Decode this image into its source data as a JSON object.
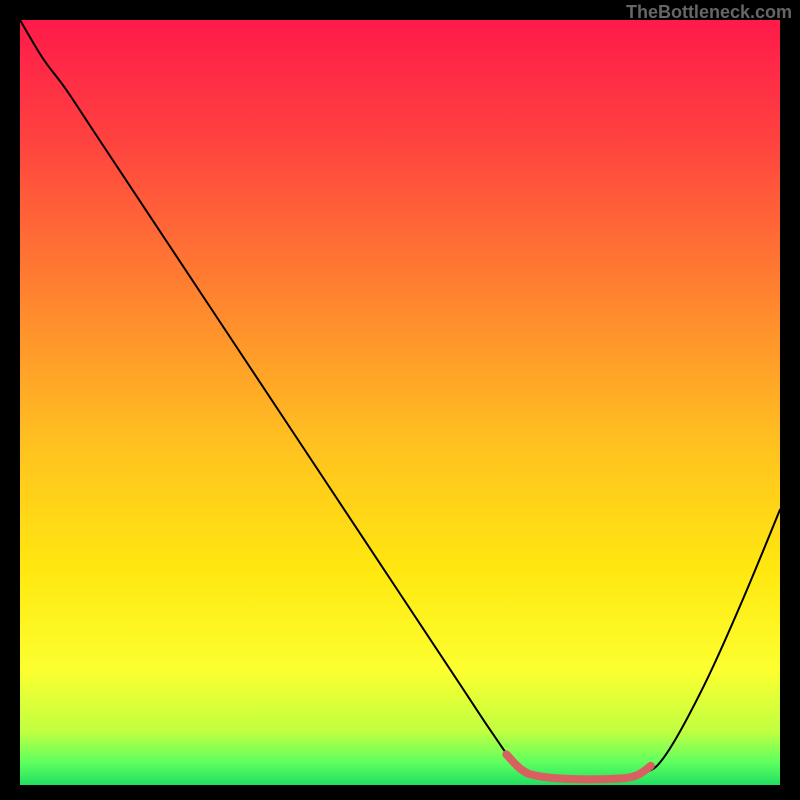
{
  "watermark": "TheBottleneck.com",
  "chart_data": {
    "type": "line",
    "title": "",
    "xlabel": "",
    "ylabel": "",
    "xlim": [
      0,
      100
    ],
    "ylim": [
      0,
      100
    ],
    "gradient_stops": [
      {
        "offset": 0.0,
        "color": "#ff1a4a"
      },
      {
        "offset": 0.15,
        "color": "#ff4040"
      },
      {
        "offset": 0.35,
        "color": "#ff8030"
      },
      {
        "offset": 0.55,
        "color": "#ffc020"
      },
      {
        "offset": 0.72,
        "color": "#ffe810"
      },
      {
        "offset": 0.85,
        "color": "#fcff30"
      },
      {
        "offset": 0.93,
        "color": "#c0ff40"
      },
      {
        "offset": 0.97,
        "color": "#60ff60"
      },
      {
        "offset": 1.0,
        "color": "#20e060"
      }
    ],
    "series": [
      {
        "name": "bottleneck-curve",
        "color": "#000000",
        "stroke_width": 2,
        "points": [
          {
            "x": 0,
            "y": 100
          },
          {
            "x": 3,
            "y": 95
          },
          {
            "x": 6,
            "y": 91
          },
          {
            "x": 10,
            "y": 85
          },
          {
            "x": 20,
            "y": 70
          },
          {
            "x": 30,
            "y": 55
          },
          {
            "x": 40,
            "y": 40
          },
          {
            "x": 50,
            "y": 25
          },
          {
            "x": 58,
            "y": 13
          },
          {
            "x": 62,
            "y": 7
          },
          {
            "x": 65,
            "y": 3
          },
          {
            "x": 68,
            "y": 1.2
          },
          {
            "x": 72,
            "y": 0.8
          },
          {
            "x": 78,
            "y": 0.8
          },
          {
            "x": 82,
            "y": 1.5
          },
          {
            "x": 85,
            "y": 4
          },
          {
            "x": 90,
            "y": 13
          },
          {
            "x": 95,
            "y": 24
          },
          {
            "x": 100,
            "y": 36
          }
        ]
      },
      {
        "name": "target-range",
        "color": "#d86060",
        "stroke_width": 8,
        "points": [
          {
            "x": 64,
            "y": 4
          },
          {
            "x": 66,
            "y": 2
          },
          {
            "x": 68,
            "y": 1.2
          },
          {
            "x": 72,
            "y": 0.8
          },
          {
            "x": 78,
            "y": 0.8
          },
          {
            "x": 81,
            "y": 1.2
          },
          {
            "x": 83,
            "y": 2.5
          }
        ]
      }
    ]
  }
}
